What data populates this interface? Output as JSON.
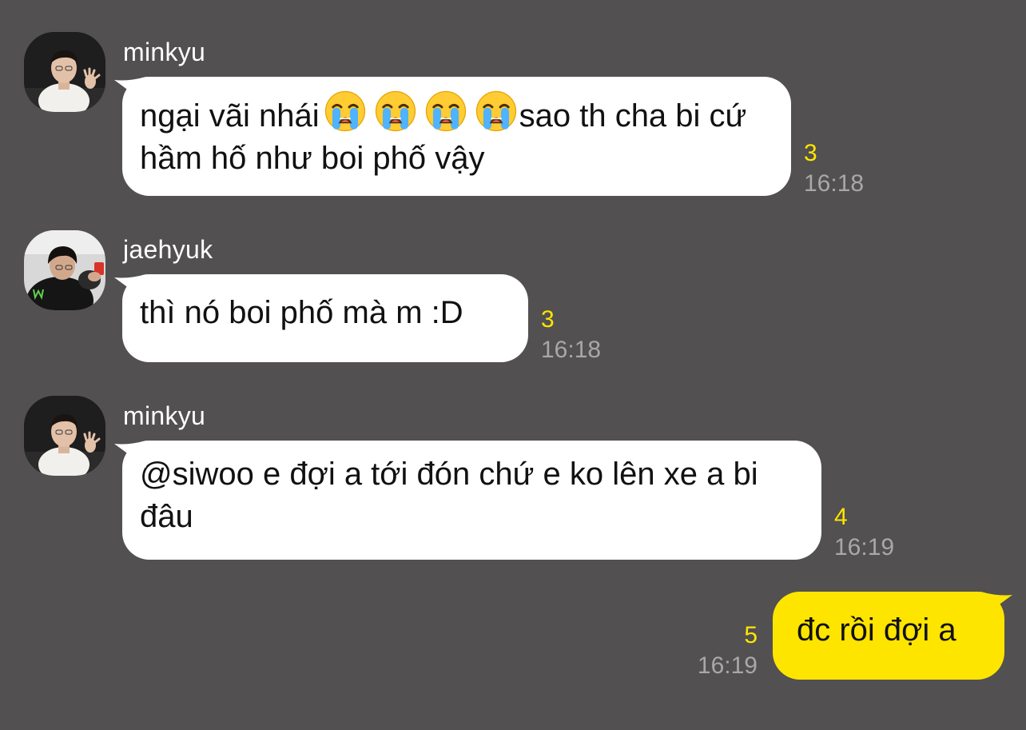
{
  "colors": {
    "background": "#525051",
    "incoming_bubble": "#ffffff",
    "outgoing_bubble": "#fee500",
    "unread_count": "#fee500",
    "timestamp": "#a9a7a8",
    "sender_name": "#ffffff"
  },
  "messages": [
    {
      "sender": "minkyu",
      "avatar_icon": "minkyu-avatar",
      "text_before_emoji": "ngại vãi nhái",
      "emoji": [
        "loudly-crying-face-icon",
        "loudly-crying-face-icon",
        "loudly-crying-face-icon",
        "loudly-crying-face-icon"
      ],
      "text_after_emoji": "sao th cha bi cứ hầm hố như boi phố vậy",
      "unread": "3",
      "time": "16:18"
    },
    {
      "sender": "jaehyuk",
      "avatar_icon": "jaehyuk-avatar",
      "text": "thì nó boi phố mà m :D",
      "unread": "3",
      "time": "16:18"
    },
    {
      "sender": "minkyu",
      "avatar_icon": "minkyu-avatar",
      "text": "@siwoo e đợi a tới đón chứ e ko lên xe a bi đâu",
      "unread": "4",
      "time": "16:19"
    },
    {
      "sender": "me",
      "text": "đc rồi đợi a",
      "unread": "5",
      "time": "16:19"
    }
  ]
}
